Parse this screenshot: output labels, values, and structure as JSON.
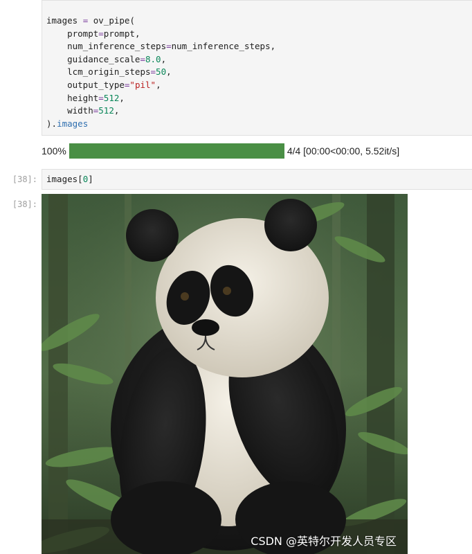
{
  "cell_code": {
    "lines": [
      {
        "segments": [
          {
            "t": "images "
          },
          {
            "t": "=",
            "c": "kw-op"
          },
          {
            "t": " ov_pipe("
          }
        ]
      },
      {
        "segments": [
          {
            "t": "    prompt"
          },
          {
            "t": "=",
            "c": "kw-op"
          },
          {
            "t": "prompt,"
          }
        ]
      },
      {
        "segments": [
          {
            "t": "    num_inference_steps"
          },
          {
            "t": "=",
            "c": "kw-op"
          },
          {
            "t": "num_inference_steps,"
          }
        ]
      },
      {
        "segments": [
          {
            "t": "    guidance_scale"
          },
          {
            "t": "=",
            "c": "kw-op"
          },
          {
            "t": "8.0",
            "c": "num"
          },
          {
            "t": ","
          }
        ]
      },
      {
        "segments": [
          {
            "t": "    lcm_origin_steps"
          },
          {
            "t": "=",
            "c": "kw-op"
          },
          {
            "t": "50",
            "c": "num"
          },
          {
            "t": ","
          }
        ]
      },
      {
        "segments": [
          {
            "t": "    output_type"
          },
          {
            "t": "=",
            "c": "kw-op"
          },
          {
            "t": "\"pil\"",
            "c": "str"
          },
          {
            "t": ","
          }
        ]
      },
      {
        "segments": [
          {
            "t": "    height"
          },
          {
            "t": "=",
            "c": "kw-op"
          },
          {
            "t": "512",
            "c": "num"
          },
          {
            "t": ","
          }
        ]
      },
      {
        "segments": [
          {
            "t": "    width"
          },
          {
            "t": "=",
            "c": "kw-op"
          },
          {
            "t": "512",
            "c": "num"
          },
          {
            "t": ","
          }
        ]
      },
      {
        "segments": [
          {
            "t": ")."
          },
          {
            "t": "images",
            "c": "attr"
          }
        ]
      }
    ]
  },
  "progress": {
    "percent_label": "100%",
    "fraction": 1.0,
    "status_text": "4/4 [00:00<00:00, 5.52it/s]"
  },
  "cell_38": {
    "prompt": "[38]:",
    "code_prefix": "images[",
    "code_index": "0",
    "code_suffix": "]"
  },
  "output_38": {
    "prompt": "[38]:"
  },
  "watermark": "CSDN @英特尔开发人员专区",
  "colors": {
    "progress_fill": "#4a8f45",
    "cell_bg": "#f5f5f5"
  }
}
